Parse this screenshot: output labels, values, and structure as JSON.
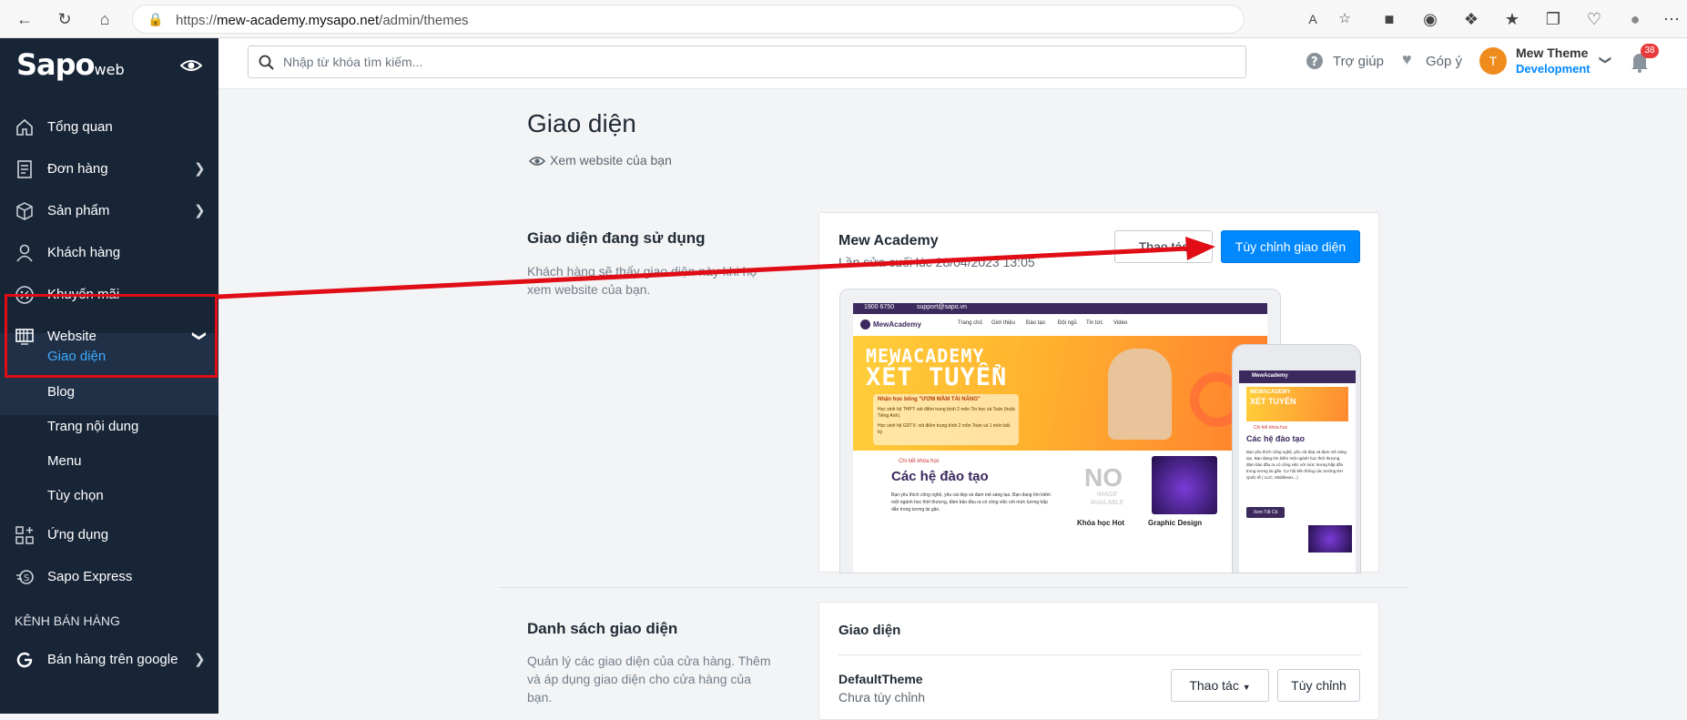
{
  "browser": {
    "url_prefix": "https://",
    "url_host": "mew-academy.mysapo.net",
    "url_path": "/admin/themes"
  },
  "sidebar": {
    "logo": "Sapo",
    "logo_suffix": "web",
    "items": [
      {
        "label": "Tổng quan"
      },
      {
        "label": "Đơn hàng"
      },
      {
        "label": "Sản phẩm"
      },
      {
        "label": "Khách hàng"
      },
      {
        "label": "Khuyến mãi"
      },
      {
        "label": "Website"
      },
      {
        "label": "Ứng dụng"
      },
      {
        "label": "Sapo Express"
      }
    ],
    "website_sub": [
      "Giao diện",
      "Blog",
      "Trang nội dung",
      "Menu",
      "Tùy chọn"
    ],
    "channel_header": "KÊNH BÁN HÀNG",
    "channel_item": "Bán hàng trên google"
  },
  "topbar": {
    "search_placeholder": "Nhập từ khóa tìm kiếm...",
    "help": "Trợ giúp",
    "feedback": "Góp ý",
    "avatar_letter": "T",
    "store_name": "Mew Theme",
    "store_env": "Development",
    "notification_count": "38"
  },
  "page": {
    "title": "Giao diện",
    "view_website": "Xem website của bạn",
    "current": {
      "title": "Giao diện đang sử dụng",
      "desc": "Khách hàng sẽ thấy giao diện này khi họ xem website của bạn.",
      "theme_name": "Mew Academy",
      "last_saved": "Lần sửa cuối lúc 28/04/2023 13:05",
      "actions_button": "Thao tác",
      "customize_button": "Tùy chỉnh giao diện"
    },
    "list": {
      "title": "Danh sách giao diện",
      "desc": "Quản lý các giao diện của cửa hàng. Thêm và áp dụng giao diện cho cửa hàng của bạn.",
      "card_header": "Giao diện",
      "theme_name": "DefaultTheme",
      "theme_status": "Chưa tùy chỉnh",
      "actions_button": "Thao tác",
      "customize_button": "Tùy chỉnh"
    }
  },
  "preview": {
    "phone": "1900 6750",
    "email": "support@sapo.vn",
    "brand": "MewAcademy",
    "menu": [
      "Trang chủ",
      "Giới thiệu",
      "Đào tạo",
      "Đội ngũ",
      "Tin tức",
      "Video"
    ],
    "banner_line1": "MEWACADEMY",
    "banner_line2": "XÉT TUYỂN",
    "banner_tag": "Nhận học bổng \"ƯƠM MẦM TÀI NĂNG\"",
    "banner_text1": "Học sinh hệ THPT: xét điểm trung bình 2 môn Tin học và Toán (hoặc Tiếng Anh).",
    "banner_text2": "Học sinh hệ GDTX: xét điểm trung bình 2 môn Toán và 1 môn bất kỳ.",
    "section_kicker": "Chi tiết khóa học",
    "section_title": "Các hệ đào tạo",
    "section_text": "Bạn yêu thích công nghệ, yêu cái đẹp và đam mê sáng tạo. Bạn đang tìm kiếm một ngành học thời thượng, đảm bảo đầu ra có công việc với mức lương hấp dẫn trong tương lai gần.",
    "no_image": "NO",
    "no_image_sub": "IMAGE AVAILABLE",
    "course1": "Khóa học Hot",
    "course2": "Graphic Design",
    "mobile_section_text": "Bạn yêu thích công nghệ, yêu cái đẹp và đam mê sáng tạo. Bạn đang tìm kiếm một ngành học thời thượng, đảm bảo đầu ra có công việc với mức lương hấp dẫn trong tương lai gần. Cơ hội liên thông các trường ĐH Quốc tế ( LUC, Middlesex...)",
    "mobile_button": "Xem Tất Cả"
  },
  "colors": {
    "sidebar_bg": "#182537",
    "accent": "#0088ff",
    "annotation_red": "#e00d16"
  }
}
